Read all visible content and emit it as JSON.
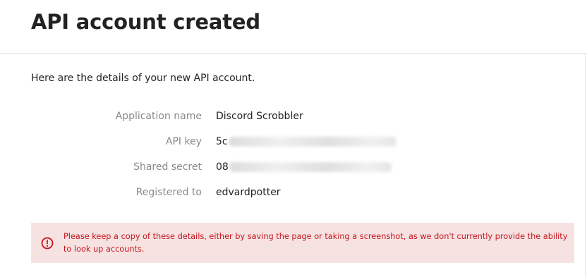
{
  "header": {
    "title": "API account created"
  },
  "intro": "Here are the details of your new API account.",
  "details": [
    {
      "label": "Application name",
      "value": "Discord Scrobbler"
    },
    {
      "label": "API key",
      "value": "5c"
    },
    {
      "label": "Shared secret",
      "value": "08"
    },
    {
      "label": "Registered to",
      "value": "edvardpotter"
    }
  ],
  "alert": {
    "icon": "alert-circle-icon",
    "text": "Please keep a copy of these details, either by saving the page or taking a screenshot, as we don't currently provide the ability to look up accounts.",
    "color": "#c4161c",
    "background": "#f7e2e2"
  }
}
